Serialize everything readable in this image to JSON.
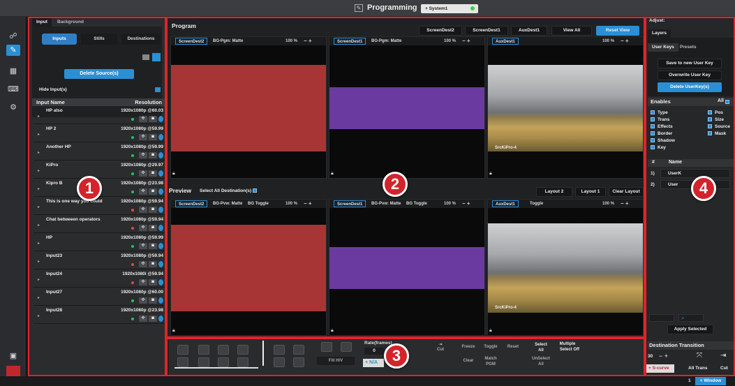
{
  "titlebar": {
    "title": "Programming",
    "system_tab": "+ System1"
  },
  "left_panel": {
    "tabs": [
      "Input",
      "Background"
    ],
    "subtabs": [
      "Inputs",
      "Stills",
      "Destinations"
    ],
    "delete_label": "Delete Source(s)",
    "hide_label": "Hide Input(s)",
    "col_name": "Input Name",
    "col_res": "Resolution",
    "rows": [
      {
        "name": "HP also",
        "res": "1920x1080p @60.03",
        "dot": "#22c55e"
      },
      {
        "name": "HP 2",
        "res": "1920x1080p @59.99",
        "dot": "#22c55e"
      },
      {
        "name": "Another HP",
        "res": "1920x1080p @59.99",
        "dot": "#22c55e"
      },
      {
        "name": "KiPro",
        "res": "1920x1080p @29.97",
        "dot": "#22c55e"
      },
      {
        "name": "Kipro B",
        "res": "1920x1080p @23.98",
        "dot": "#22c55e"
      },
      {
        "name": "This is one way you could",
        "res": "1920x1080p @59.94",
        "dot": "#ef4444"
      },
      {
        "name": "Chat betweeen operators",
        "res": "1920x1080p @59.94",
        "dot": "#ef4444"
      },
      {
        "name": "HP",
        "res": "1920x1080p @59.99",
        "dot": "#22c55e"
      },
      {
        "name": "Input23",
        "res": "1920x1080p @59.94",
        "dot": "#ef4444"
      },
      {
        "name": "Input24",
        "res": "1920x1080i @59.94",
        "dot": "#ef4444"
      },
      {
        "name": "Input27",
        "res": "1920x1080p @60.00",
        "dot": "#22c55e"
      },
      {
        "name": "Input28",
        "res": "1920x1080p @23.98",
        "dot": "#22c55e"
      }
    ]
  },
  "program": {
    "label": "Program",
    "buttons": [
      "ScreenDest2",
      "ScreenDest1",
      "AuxDest1",
      "View All",
      "Reset View"
    ],
    "views": [
      {
        "dest": "ScreenDest2",
        "bg": "BG-Pgm: Matte",
        "pct": "100 %",
        "color": "#a83535"
      },
      {
        "dest": "ScreenDest1",
        "bg": "BG-Pgm: Matte",
        "pct": "100 %",
        "color": "#6b3aa0"
      },
      {
        "dest": "AuxDest1",
        "bg": "",
        "pct": "100 %",
        "source": "SrcKiPro-4"
      }
    ]
  },
  "preview": {
    "label": "Preview",
    "select_all": "Select All Destination(s)",
    "buttons": [
      "Layout 2",
      "Layout 1",
      "Clear Layout"
    ],
    "views": [
      {
        "dest": "ScreenDest2",
        "bg": "BG-Pvw: Matte",
        "toggle": "BG Toggle",
        "pct": "100 %"
      },
      {
        "dest": "ScreenDest1",
        "bg": "BG-Pvw: Matte",
        "toggle": "BG Toggle",
        "pct": "100 %"
      },
      {
        "dest": "AuxDest1",
        "bg": "Toggle",
        "toggle": "",
        "pct": "100 %",
        "source": "SrcKiPro-4"
      }
    ]
  },
  "bottom": {
    "fill": "Fill H/V",
    "rate": "Rate(frames)",
    "rate_val": "0",
    "na": "+ N/A",
    "cut": "Cut",
    "freeze": "Freeze",
    "toggle": "Toggle",
    "reset": "Reset",
    "clear": "Clear",
    "match": "Match PGM",
    "select_all": "Select All",
    "unselect_all": "UnSelect All",
    "multiple": "Multiple",
    "select_off": "Select Off"
  },
  "right_panel": {
    "adjust": "Adjust:",
    "layers": "Layers",
    "subtabs": [
      "User Keys",
      "Presets"
    ],
    "btn_save": "Save to new User Key",
    "btn_over": "Overwrite User Key",
    "btn_del": "Delete UserKey(s)",
    "enables": "Enables",
    "all": "All",
    "left_opts": [
      "Type",
      "Trans",
      "Effects",
      "Border",
      "Shadow",
      "Key"
    ],
    "right_opts": [
      "Pos",
      "Size",
      "Source",
      "Mask"
    ],
    "col_num": "#",
    "col_name": "Name",
    "keys": [
      {
        "n": "1)",
        "name": "UserK"
      },
      {
        "n": "2)",
        "name": "User"
      }
    ],
    "apply": "Apply Selected",
    "dest_trans": "Destination Transition",
    "trans_val": "30",
    "scurve": "+ S-curve",
    "alltrans": "All Trans",
    "cut": "Cut"
  },
  "footer": {
    "page": "1",
    "window": "+ Window"
  },
  "badges": [
    "1",
    "2",
    "3",
    "4"
  ]
}
